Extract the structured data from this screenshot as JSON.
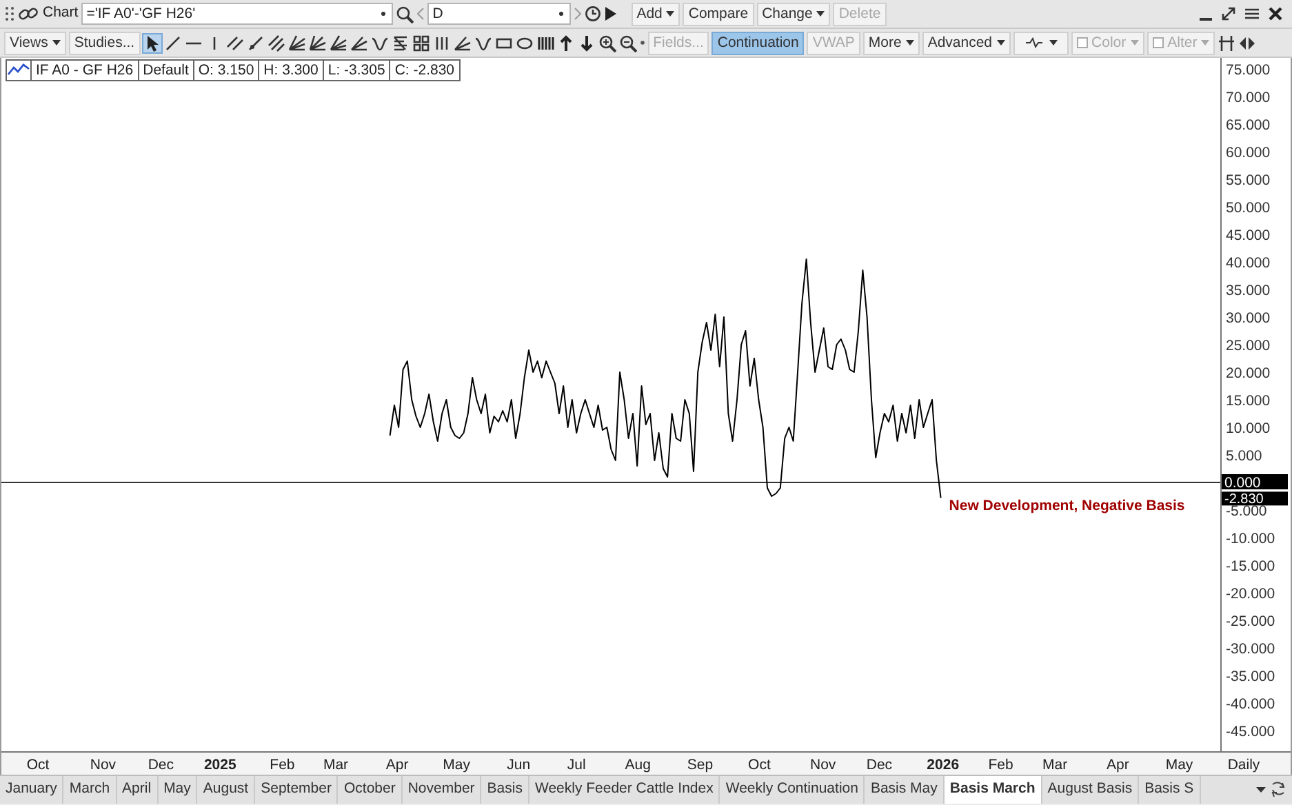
{
  "title_bar": {
    "title": "Chart",
    "symbol": "='IF A0'-'GF H26'",
    "interval": "D",
    "buttons": [
      {
        "label": "Add",
        "kind": "dropdown",
        "disabled": false
      },
      {
        "label": "Compare",
        "kind": "button",
        "disabled": false
      },
      {
        "label": "Change",
        "kind": "dropdown",
        "disabled": false
      },
      {
        "label": "Delete",
        "kind": "button",
        "disabled": true
      }
    ]
  },
  "toolbar": {
    "left_buttons": [
      {
        "label": "Views",
        "kind": "dropdown"
      },
      {
        "label": "Studies...",
        "kind": "button"
      }
    ],
    "pointer_selected": true,
    "right_buttons": [
      {
        "label": "Fields...",
        "kind": "button",
        "disabled": true,
        "active": false
      },
      {
        "label": "Continuation",
        "kind": "button",
        "disabled": false,
        "active": true
      },
      {
        "label": "VWAP",
        "kind": "button",
        "disabled": true,
        "active": false
      },
      {
        "label": "More",
        "kind": "dropdown",
        "disabled": false,
        "active": false
      },
      {
        "label": "Advanced",
        "kind": "dropdown",
        "disabled": false,
        "active": false
      },
      {
        "kind": "icon-dropdown",
        "disabled": false,
        "active": false
      },
      {
        "label": "Color",
        "kind": "checkbox-dropdown",
        "disabled": true,
        "active": false
      },
      {
        "label": "Alter",
        "kind": "checkbox-dropdown",
        "disabled": true,
        "active": false
      }
    ]
  },
  "legend": {
    "cells": [
      "Default",
      "O: 3.150",
      "H: 3.300",
      "L: -3.305",
      "C: -2.830"
    ]
  },
  "chart": {
    "last_value_label": "-2.830",
    "chart_data": {
      "type": "line",
      "xlabel": "Daily",
      "x": [
        2025.235,
        2025.241,
        2025.247,
        2025.253,
        2025.259,
        2025.265,
        2025.271,
        2025.277,
        2025.283,
        2025.289,
        2025.295,
        2025.301,
        2025.307,
        2025.313,
        2025.319,
        2025.325,
        2025.331,
        2025.337,
        2025.343,
        2025.349,
        2025.355,
        2025.361,
        2025.367,
        2025.373,
        2025.379,
        2025.385,
        2025.391,
        2025.397,
        2025.403,
        2025.409,
        2025.415,
        2025.421,
        2025.427,
        2025.433,
        2025.439,
        2025.445,
        2025.451,
        2025.457,
        2025.463,
        2025.469,
        2025.475,
        2025.481,
        2025.487,
        2025.493,
        2025.499,
        2025.505,
        2025.511,
        2025.517,
        2025.523,
        2025.529,
        2025.535,
        2025.541,
        2025.547,
        2025.553,
        2025.559,
        2025.565,
        2025.571,
        2025.577,
        2025.583,
        2025.589,
        2025.595,
        2025.601,
        2025.607,
        2025.613,
        2025.619,
        2025.625,
        2025.631,
        2025.637,
        2025.643,
        2025.649,
        2025.655,
        2025.661,
        2025.667,
        2025.673,
        2025.679,
        2025.685,
        2025.691,
        2025.697,
        2025.703,
        2025.709,
        2025.715,
        2025.721,
        2025.727,
        2025.733,
        2025.739,
        2025.745,
        2025.751,
        2025.757,
        2025.763,
        2025.769,
        2025.775,
        2025.781,
        2025.787,
        2025.793,
        2025.799,
        2025.805,
        2025.811,
        2025.817,
        2025.823,
        2025.829,
        2025.835,
        2025.841,
        2025.847,
        2025.853,
        2025.859,
        2025.865,
        2025.871,
        2025.877,
        2025.883,
        2025.889,
        2025.895,
        2025.901,
        2025.907,
        2025.913,
        2025.919,
        2025.925,
        2025.931,
        2025.937,
        2025.943,
        2025.949,
        2025.955,
        2025.961,
        2025.967,
        2025.973,
        2025.979,
        2025.985,
        2025.991,
        2025.997
      ],
      "series": [
        {
          "name": "IF A0 - GF H26",
          "color": "#000000",
          "values": [
            8.5,
            14,
            10,
            20.5,
            22,
            15,
            12,
            10,
            12.5,
            16,
            11,
            7.5,
            12.5,
            15,
            10,
            8.5,
            8,
            9,
            12.5,
            19,
            15,
            12.5,
            16,
            9,
            12,
            11,
            13,
            11,
            15,
            8,
            12.5,
            19,
            24,
            20,
            22,
            19,
            22,
            20,
            18,
            12.5,
            17.5,
            10,
            15,
            9,
            12.5,
            15,
            12.5,
            10,
            14,
            9.5,
            10,
            6,
            4,
            20,
            15,
            8,
            12.5,
            3,
            17.5,
            10.5,
            12.5,
            4,
            9,
            2.5,
            1,
            12.5,
            8,
            7.5,
            15,
            12.5,
            2,
            20,
            25.5,
            29,
            24,
            30.5,
            21,
            30,
            12.5,
            7.5,
            15,
            25,
            27.5,
            17.5,
            22.5,
            15,
            10,
            -1,
            -2.5,
            -2,
            -1,
            8,
            10,
            7.5,
            20,
            32.5,
            40.5,
            29,
            20,
            24,
            28,
            21,
            20.5,
            25,
            26,
            24,
            20.5,
            20,
            27.5,
            38.5,
            30,
            15,
            4.5,
            9,
            12.5,
            11,
            14,
            7.5,
            12.5,
            9,
            14,
            8,
            15,
            10,
            12.5,
            15,
            4,
            -2.8
          ]
        }
      ],
      "xlim": [
        2024.705,
        2026.481
      ],
      "ylim": [
        -48.75,
        77
      ],
      "xticks": [
        {
          "value": 2024.748,
          "label": "Oct"
        },
        {
          "value": 2024.838,
          "label": "Nov"
        },
        {
          "value": 2024.918,
          "label": "Dec"
        },
        2025,
        {
          "value": 2025.086,
          "label": "Feb"
        },
        {
          "value": 2025.16,
          "label": "Mar"
        },
        {
          "value": 2025.245,
          "label": "Apr"
        },
        {
          "value": 2025.327,
          "label": "May"
        },
        {
          "value": 2025.413,
          "label": "Jun"
        },
        {
          "value": 2025.493,
          "label": "Jul"
        },
        {
          "value": 2025.578,
          "label": "Aug"
        },
        {
          "value": 2025.664,
          "label": "Sep"
        },
        {
          "value": 2025.746,
          "label": "Oct"
        },
        {
          "value": 2025.834,
          "label": "Nov"
        },
        {
          "value": 2025.912,
          "label": "Dec"
        },
        2026,
        {
          "value": 2026.08,
          "label": "Feb"
        },
        {
          "value": 2026.155,
          "label": "Mar"
        },
        {
          "value": 2026.242,
          "label": "Apr"
        },
        {
          "value": 2026.327,
          "label": "May"
        }
      ],
      "yticks": [
        {
          "value": 75,
          "label": "75.000"
        },
        {
          "value": 70,
          "label": "70.000"
        },
        {
          "value": 65,
          "label": "65.000"
        },
        {
          "value": 60,
          "label": "60.000"
        },
        {
          "value": 55,
          "label": "55.000"
        },
        {
          "value": 50,
          "label": "50.000"
        },
        {
          "value": 45,
          "label": "45.000"
        },
        {
          "value": 40,
          "label": "40.000"
        },
        {
          "value": 35,
          "label": "35.000"
        },
        {
          "value": 30,
          "label": "30.000"
        },
        {
          "value": 25,
          "label": "25.000"
        },
        {
          "value": 20,
          "label": "20.000"
        },
        {
          "value": 15,
          "label": "15.000"
        },
        {
          "value": 10,
          "label": "10.000"
        },
        {
          "value": 5,
          "label": "5.000"
        },
        {
          "value": 0,
          "label": "0.000"
        },
        {
          "value": -5,
          "label": "-5.000"
        },
        {
          "value": -10,
          "label": "-10.000"
        },
        {
          "value": -15,
          "label": "-15.000"
        },
        {
          "value": -20,
          "label": "-20.000"
        },
        {
          "value": -25,
          "label": "-25.000"
        },
        {
          "value": -30,
          "label": "-30.000"
        },
        {
          "value": -35,
          "label": "-35.000"
        },
        {
          "value": -40,
          "label": "-40.000"
        },
        {
          "value": -45,
          "label": "-45.000"
        }
      ],
      "annotations": [
        "New Development, Negative Basis"
      ]
    }
  },
  "tabs": [
    {
      "label": "January",
      "selected": false
    },
    {
      "label": "March",
      "selected": false
    },
    {
      "label": "April",
      "selected": false
    },
    {
      "label": "May",
      "selected": false
    },
    {
      "label": "August",
      "selected": false
    },
    {
      "label": "September",
      "selected": false
    },
    {
      "label": "October",
      "selected": false
    },
    {
      "label": "November",
      "selected": false
    },
    {
      "label": "Basis",
      "selected": false
    },
    {
      "label": "Weekly Feeder Cattle Index",
      "selected": false
    },
    {
      "label": "Weekly Continuation",
      "selected": false
    },
    {
      "label": "Basis May",
      "selected": false
    },
    {
      "label": "Basis March",
      "selected": true
    },
    {
      "label": "August Basis",
      "selected": false
    },
    {
      "label": "Basis S",
      "selected": false
    }
  ]
}
